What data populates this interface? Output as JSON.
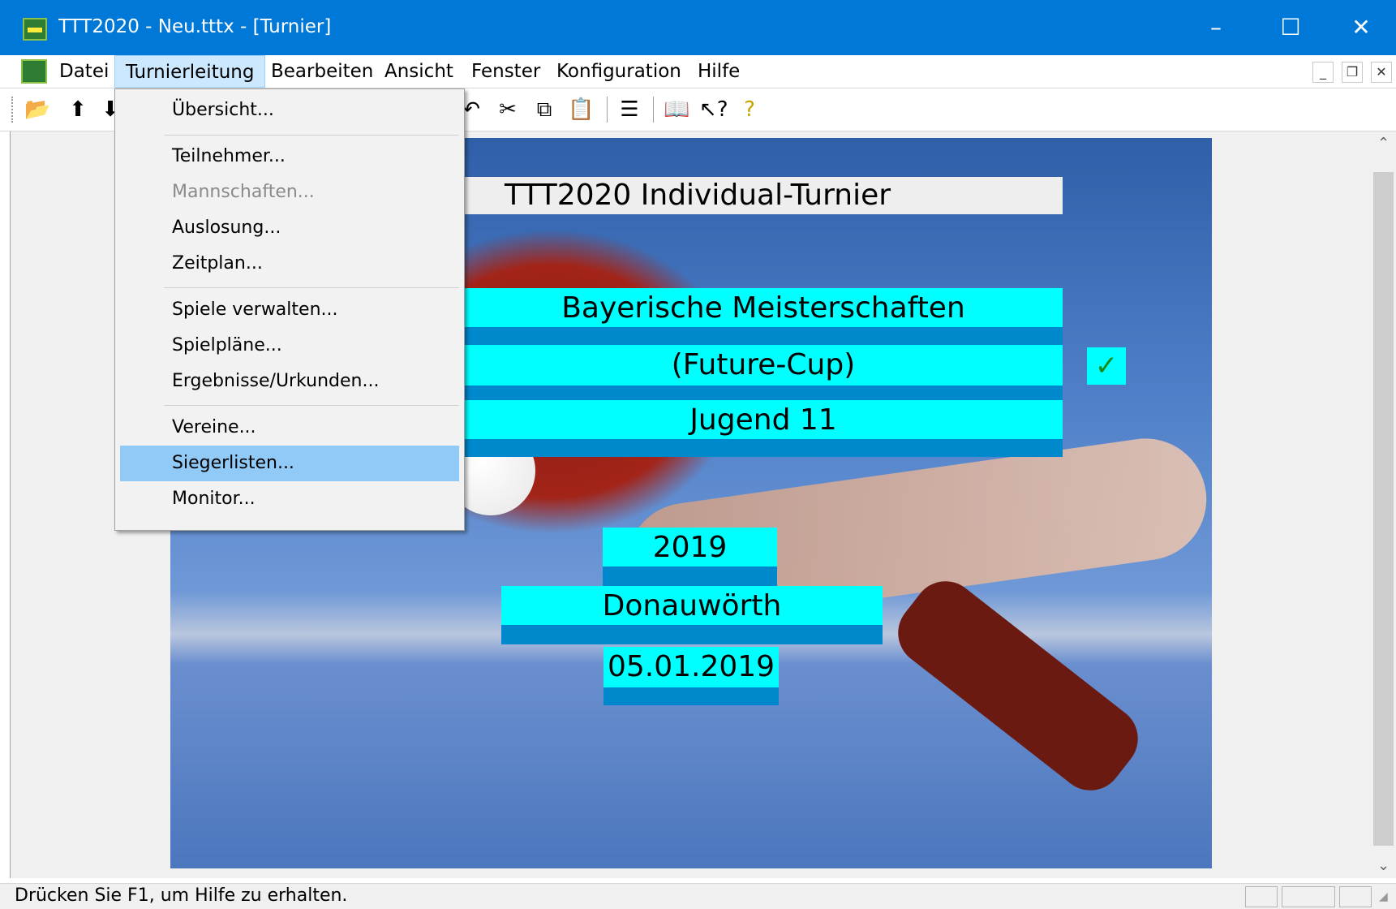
{
  "window": {
    "title": "TTT2020 - Neu.tttx - [Turnier]",
    "minimize": "–",
    "maximize": "☐",
    "close": "✕"
  },
  "menubar": {
    "items": [
      "Datei",
      "Turnierleitung",
      "Bearbeiten",
      "Ansicht",
      "Fenster",
      "Konfiguration",
      "Hilfe"
    ],
    "active": "Turnierleitung",
    "mdi_buttons": [
      "_",
      "❐",
      "✕"
    ]
  },
  "toolbar": {
    "icons": [
      "open-icon",
      "import-icon",
      "export-icon",
      "undo-icon",
      "cut-icon",
      "copy-icon",
      "paste-icon",
      "list-icon",
      "book-icon",
      "context-help-icon",
      "help-icon"
    ]
  },
  "dropdown": {
    "items": [
      {
        "label": "Übersicht...",
        "enabled": true
      },
      {
        "label": "Teilnehmer...",
        "enabled": true
      },
      {
        "label": "Mannschaften...",
        "enabled": false
      },
      {
        "label": "Auslosung...",
        "enabled": true
      },
      {
        "label": "Zeitplan...",
        "enabled": true
      },
      {
        "label": "Spiele verwalten...",
        "enabled": true
      },
      {
        "label": "Spielpläne...",
        "enabled": true
      },
      {
        "label": "Ergebnisse/Urkunden...",
        "enabled": true
      },
      {
        "label": "Vereine...",
        "enabled": true
      },
      {
        "label": "Siegerlisten...",
        "enabled": true,
        "highlighted": true
      },
      {
        "label": "Monitor...",
        "enabled": true
      }
    ]
  },
  "tournament": {
    "type": "TTT2020 Individual-Turnier",
    "name_line1": "Bayerische Meisterschaften",
    "name_line2": "(Future-Cup)",
    "category": "Jugend 11",
    "year": "2019",
    "location": "Donauwörth",
    "date": "05.01.2019",
    "check_mark": "✓"
  },
  "status": {
    "text": "Drücken Sie F1, um Hilfe zu erhalten."
  },
  "colors": {
    "titlebar": "#0078d7",
    "banner": "#00ffff",
    "banner_shade": "#0088cc",
    "menu_highlight": "#91c9f7"
  }
}
